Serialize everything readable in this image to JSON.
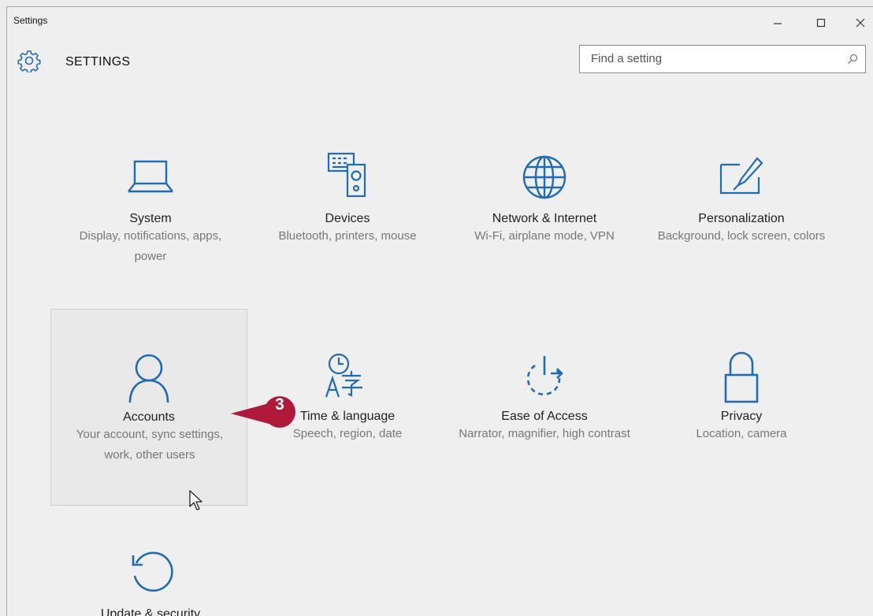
{
  "window": {
    "title": "Settings"
  },
  "header": {
    "title": "SETTINGS",
    "search_placeholder": "Find a setting"
  },
  "tiles": [
    {
      "name": "System",
      "desc": "Display, notifications, apps, power",
      "icon": "laptop-icon"
    },
    {
      "name": "Devices",
      "desc": "Bluetooth, printers, mouse",
      "icon": "devices-icon"
    },
    {
      "name": "Network & Internet",
      "desc": "Wi-Fi, airplane mode, VPN",
      "icon": "globe-icon"
    },
    {
      "name": "Personalization",
      "desc": "Background, lock screen, colors",
      "icon": "paint-icon"
    },
    {
      "name": "Accounts",
      "desc": "Your account, sync settings, work, other users",
      "icon": "person-icon"
    },
    {
      "name": "Time & language",
      "desc": "Speech, region, date",
      "icon": "time-language-icon"
    },
    {
      "name": "Ease of Access",
      "desc": "Narrator, magnifier, high contrast",
      "icon": "ease-of-access-icon"
    },
    {
      "name": "Privacy",
      "desc": "Location, camera",
      "icon": "lock-icon"
    },
    {
      "name": "Update & security",
      "desc": "",
      "icon": "update-icon"
    }
  ],
  "callout": {
    "number": "3"
  },
  "colors": {
    "accent": "#1f6bb5",
    "callout": "#b0193a"
  }
}
